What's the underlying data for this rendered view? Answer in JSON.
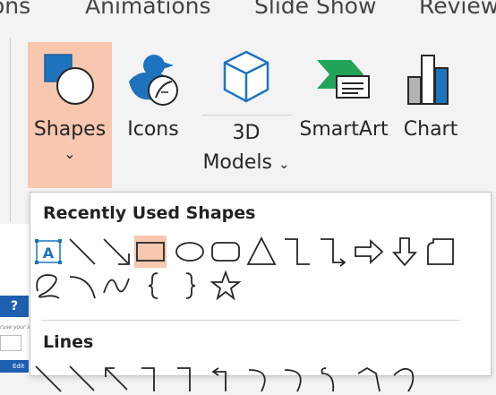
{
  "tabs": [
    "ons",
    "Animations",
    "Slide Show",
    "Review"
  ],
  "ribbon": {
    "shapes_label": "Shapes",
    "icons_label": "Icons",
    "models_label_1": "3D",
    "models_label_2": "Models",
    "smartart_label": "SmartArt",
    "chart_label": "Chart",
    "dropdown_glyph": "⌄"
  },
  "doc": {
    "help": "?",
    "hint": "ruse your image",
    "edit": "Edit"
  },
  "panel": {
    "recent_title": "Recently Used Shapes",
    "lines_title": "Lines",
    "recent_shapes": [
      "text-box",
      "line",
      "arrow-line",
      "rectangle",
      "oval",
      "rounded-rectangle",
      "triangle",
      "elbow-connector",
      "elbow-arrow-connector",
      "right-arrow",
      "down-arrow",
      "flowchart-shape",
      "freeform-scribble",
      "curve",
      "squiggle",
      "left-brace",
      "right-brace",
      "star"
    ]
  },
  "colors": {
    "accent": "#f8c7b0",
    "shape_blue": "#1e73be",
    "shape_green": "#23a35a"
  }
}
